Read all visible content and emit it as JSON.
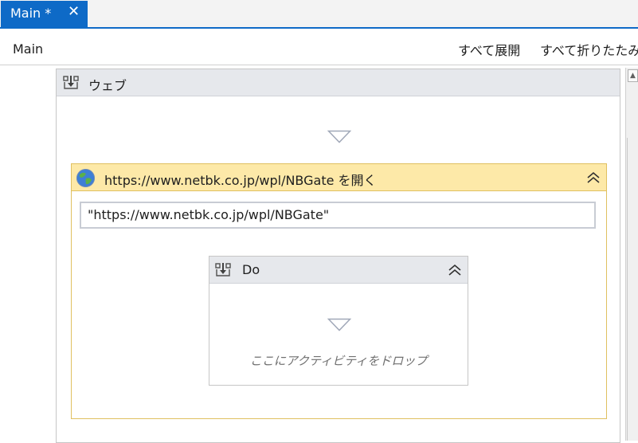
{
  "tab": {
    "title": "Main *",
    "close_glyph": "✕"
  },
  "header": {
    "breadcrumb": "Main",
    "expand_all": "すべて展開",
    "collapse_all": "すべて折りたたみ"
  },
  "sequence": {
    "title": "ウェブ",
    "icon": "sequence-icon"
  },
  "open_browser": {
    "title": "https://www.netbk.co.jp/wpl/NBGate を開く",
    "icon": "globe-icon",
    "url_value": "\"https://www.netbk.co.jp/wpl/NBGate\""
  },
  "do_container": {
    "title": "Do",
    "icon": "sequence-icon",
    "drop_hint": "ここにアクティビティをドロップ"
  },
  "colors": {
    "tab_accent": "#0e6ac7",
    "activity_header": "#fde9a8",
    "activity_border": "#e0c060",
    "sequence_header": "#e6e8ec"
  }
}
